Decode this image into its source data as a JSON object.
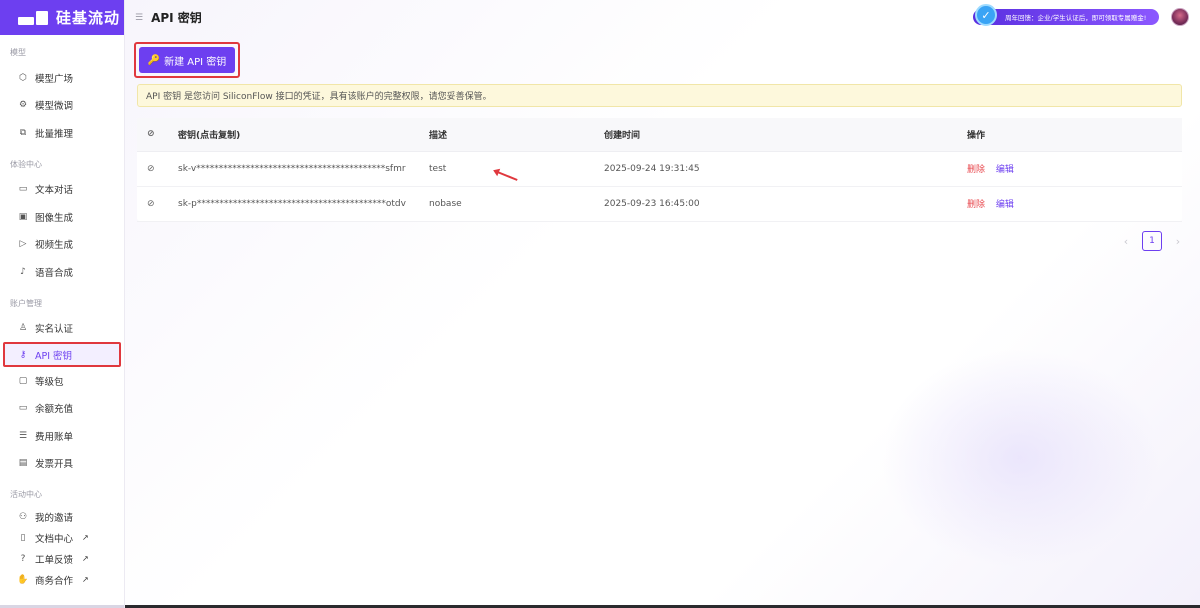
{
  "app": {
    "logo_text": "硅基流动",
    "page_title": "API 密钥"
  },
  "colors": {
    "brand": "#6d3ff0",
    "danger": "#e8484e",
    "highlight_border": "#e0383e",
    "notice_bg": "#fdf8dc"
  },
  "sidebar": {
    "sections": [
      {
        "title": "模型",
        "items": [
          {
            "label": "模型广场",
            "icon": "cube-icon"
          },
          {
            "label": "模型微调",
            "icon": "tune-icon"
          },
          {
            "label": "批量推理",
            "icon": "batch-icon"
          }
        ]
      },
      {
        "title": "体验中心",
        "items": [
          {
            "label": "文本对话",
            "icon": "chat-icon"
          },
          {
            "label": "图像生成",
            "icon": "image-icon"
          },
          {
            "label": "视频生成",
            "icon": "video-icon"
          },
          {
            "label": "语音合成",
            "icon": "mic-icon"
          }
        ]
      },
      {
        "title": "账户管理",
        "items": [
          {
            "label": "实名认证",
            "icon": "user-check-icon"
          },
          {
            "label": "API 密钥",
            "icon": "key-icon",
            "active": true
          },
          {
            "label": "等级包",
            "icon": "package-icon"
          },
          {
            "label": "余额充值",
            "icon": "card-icon"
          },
          {
            "label": "费用账单",
            "icon": "bill-icon"
          },
          {
            "label": "发票开具",
            "icon": "invoice-icon"
          }
        ]
      },
      {
        "title": "活动中心",
        "items": [
          {
            "label": "我的邀请",
            "icon": "invite-icon"
          }
        ]
      }
    ],
    "footer_links": [
      {
        "label": "文档中心",
        "ext": "↗",
        "icon": "doc-icon"
      },
      {
        "label": "工单反馈",
        "ext": "↗",
        "icon": "help-icon"
      },
      {
        "label": "商务合作",
        "ext": "↗",
        "icon": "handshake-icon"
      }
    ]
  },
  "topbar": {
    "menu_glyph": "☰",
    "promo_text": "周年回馈：企业/学生认证后，即可领取专属赠金!",
    "promo_badge_glyph": "✓"
  },
  "actions": {
    "new_key_label": "新建 API 密钥",
    "new_key_glyph": "🔑"
  },
  "notice": {
    "text": "API 密钥 是您访问 SiliconFlow 接口的凭证，具有该账户的完整权限，请您妥善保管。"
  },
  "table": {
    "headers": {
      "eye": "⊘",
      "key": "密钥(点击复制)",
      "desc": "描述",
      "created": "创建时间",
      "ops": "操作"
    },
    "rows": [
      {
        "eye": "⊘",
        "key": "sk-v******************************************sfmr",
        "desc": "test",
        "created": "2025-09-24 19:31:45",
        "delete": "删除",
        "edit": "编辑"
      },
      {
        "eye": "⊘",
        "key": "sk-p******************************************otdv",
        "desc": "nobase",
        "created": "2025-09-23 16:45:00",
        "delete": "删除",
        "edit": "编辑"
      }
    ]
  },
  "pagination": {
    "prev": "‹",
    "current": "1",
    "next": "›"
  }
}
